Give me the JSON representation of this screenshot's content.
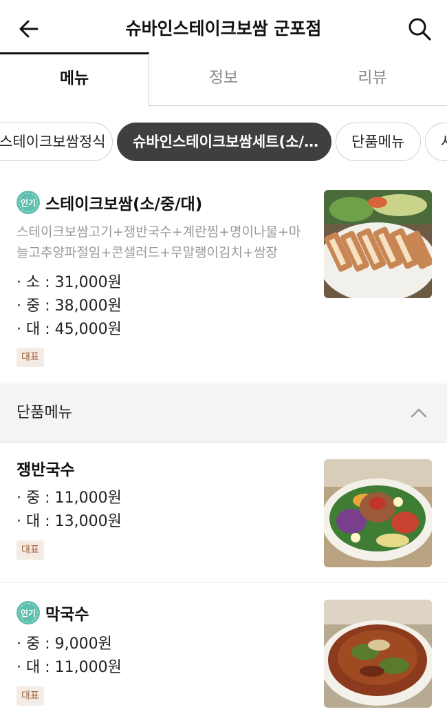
{
  "header": {
    "title": "슈바인스테이크보쌈 군포점",
    "back_icon": "arrow-left-icon",
    "search_icon": "search-icon"
  },
  "tabs": [
    {
      "label": "메뉴",
      "active": true
    },
    {
      "label": "정보",
      "active": false
    },
    {
      "label": "리뷰",
      "active": false
    }
  ],
  "categories": [
    {
      "label": "스테이크보쌈정식",
      "active": false
    },
    {
      "label": "슈바인스테이크보쌈세트(소/…",
      "active": true
    },
    {
      "label": "단품메뉴",
      "active": false
    },
    {
      "label": "사",
      "active": false
    }
  ],
  "featured_item": {
    "popular_badge": "인기",
    "name": "스테이크보쌈(소/중/대)",
    "description": "스테이크보쌈고기+쟁반국수+계란찜+명이나물+마늘고추양파절임+콘샐러드+무말랭이김치+쌈장",
    "prices": [
      "· 소 : 31,000원",
      "· 중 : 38,000원",
      "· 대 : 45,000원"
    ],
    "tag": "대표"
  },
  "section": {
    "title": "단품메뉴",
    "collapse_icon": "chevron-up-icon"
  },
  "items": [
    {
      "popular_badge": "",
      "name": "쟁반국수",
      "prices": [
        "· 중 : 11,000원",
        "· 대 : 13,000원"
      ],
      "tag": "대표"
    },
    {
      "popular_badge": "인기",
      "name": "막국수",
      "prices": [
        "· 중 : 9,000원",
        "· 대 : 11,000원"
      ],
      "tag": "대표"
    }
  ],
  "colors": {
    "popular_badge": "#5dbfae",
    "active_chip": "#3f3f3f",
    "tag_bg": "#f3ebe4",
    "tag_text": "#a0603a"
  }
}
